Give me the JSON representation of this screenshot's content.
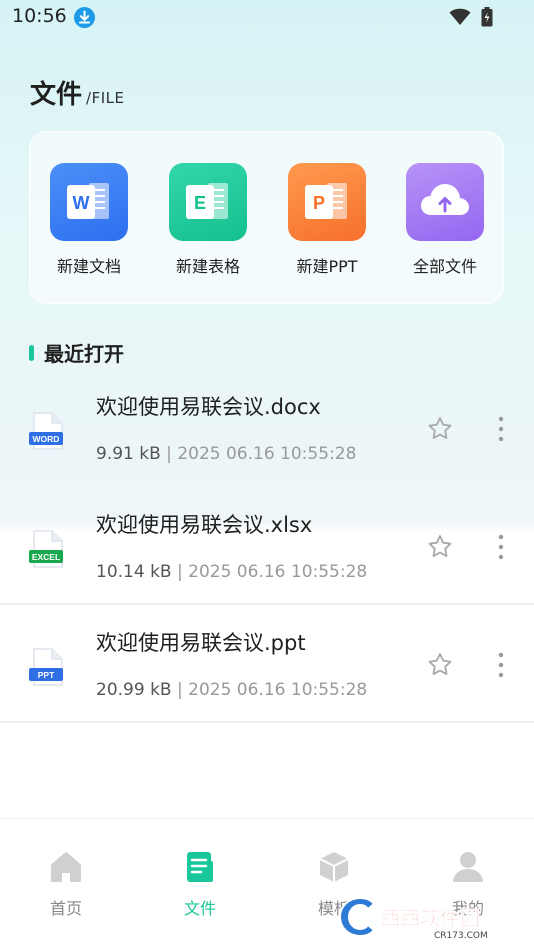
{
  "status_bar": {
    "time": "10:56"
  },
  "header": {
    "title": "文件",
    "subtitle": "/FILE"
  },
  "quick_actions": [
    {
      "label": "新建文档",
      "tile_letter": "W",
      "color": "#3a7ef5"
    },
    {
      "label": "新建表格",
      "tile_letter": "E",
      "color": "#1cc597"
    },
    {
      "label": "新建PPT",
      "tile_letter": "P",
      "color": "#fa7d37"
    },
    {
      "label": "全部文件",
      "tile_letter": "",
      "color": "#a47af4"
    }
  ],
  "recent": {
    "title": "最近打开",
    "files": [
      {
        "name": "欢迎使用易联会议.docx",
        "size": "9.91 kB",
        "separator": "|",
        "date": "2025 06.16 10:55:28",
        "badge": "WORD",
        "badge_color": "#2f6fe6"
      },
      {
        "name": "欢迎使用易联会议.xlsx",
        "size": "10.14 kB",
        "separator": "|",
        "date": "2025 06.16 10:55:28",
        "badge": "EXCEL",
        "badge_color": "#1aa84f"
      },
      {
        "name": "欢迎使用易联会议.ppt",
        "size": "20.99 kB",
        "separator": "|",
        "date": "2025 06.16 10:55:28",
        "badge": "PPT",
        "badge_color": "#2f6fe6"
      }
    ]
  },
  "bottom_nav": [
    {
      "label": "首页",
      "icon": "home-icon",
      "active": false
    },
    {
      "label": "文件",
      "icon": "file-icon",
      "active": true
    },
    {
      "label": "模板",
      "icon": "cube-icon",
      "active": false
    },
    {
      "label": "我的",
      "icon": "user-icon",
      "active": false
    }
  ],
  "watermark": {
    "text": "西西软件园",
    "sub": "CR173.COM"
  },
  "colors": {
    "accent": "#19c79a",
    "muted": "#888888",
    "icon_gray": "#cfcfcf"
  }
}
